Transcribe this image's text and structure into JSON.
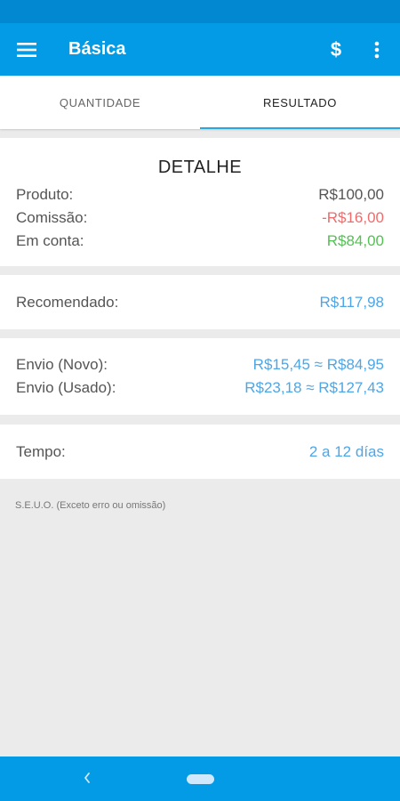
{
  "app": {
    "title": "Básica"
  },
  "tabs": [
    {
      "label": "QUANTIDADE",
      "active": false
    },
    {
      "label": "RESULTADO",
      "active": true
    }
  ],
  "detail": {
    "title": "DETALHE",
    "rows": [
      {
        "label": "Produto:",
        "value": "R$100,00"
      },
      {
        "label": "Comissão:",
        "value": "-R$16,00"
      },
      {
        "label": "Em conta:",
        "value": "R$84,00"
      }
    ]
  },
  "recommended": {
    "label": "Recomendado:",
    "value": "R$117,98"
  },
  "shipping": {
    "rows": [
      {
        "label": "Envio (Novo):",
        "value": "R$15,45 ≈ R$84,95"
      },
      {
        "label": "Envio (Usado):",
        "value": "R$23,18 ≈ R$127,43"
      }
    ]
  },
  "time": {
    "label": "Tempo:",
    "value": "2 a 12 días"
  },
  "footnote": "S.E.U.O. (Exceto erro ou omissão)",
  "icons": {
    "menu": "menu-icon",
    "dollar": "dollar-icon",
    "more": "more-vert-icon",
    "back": "back-icon",
    "home": "home-pill-icon"
  },
  "colors": {
    "app_bar": "#039be5",
    "status_bar": "#0288d1",
    "accent": "#29a8e0",
    "value_blue": "#4ea6e6",
    "negative": "#f06b6b",
    "positive": "#53c153",
    "background": "#ebebeb"
  }
}
